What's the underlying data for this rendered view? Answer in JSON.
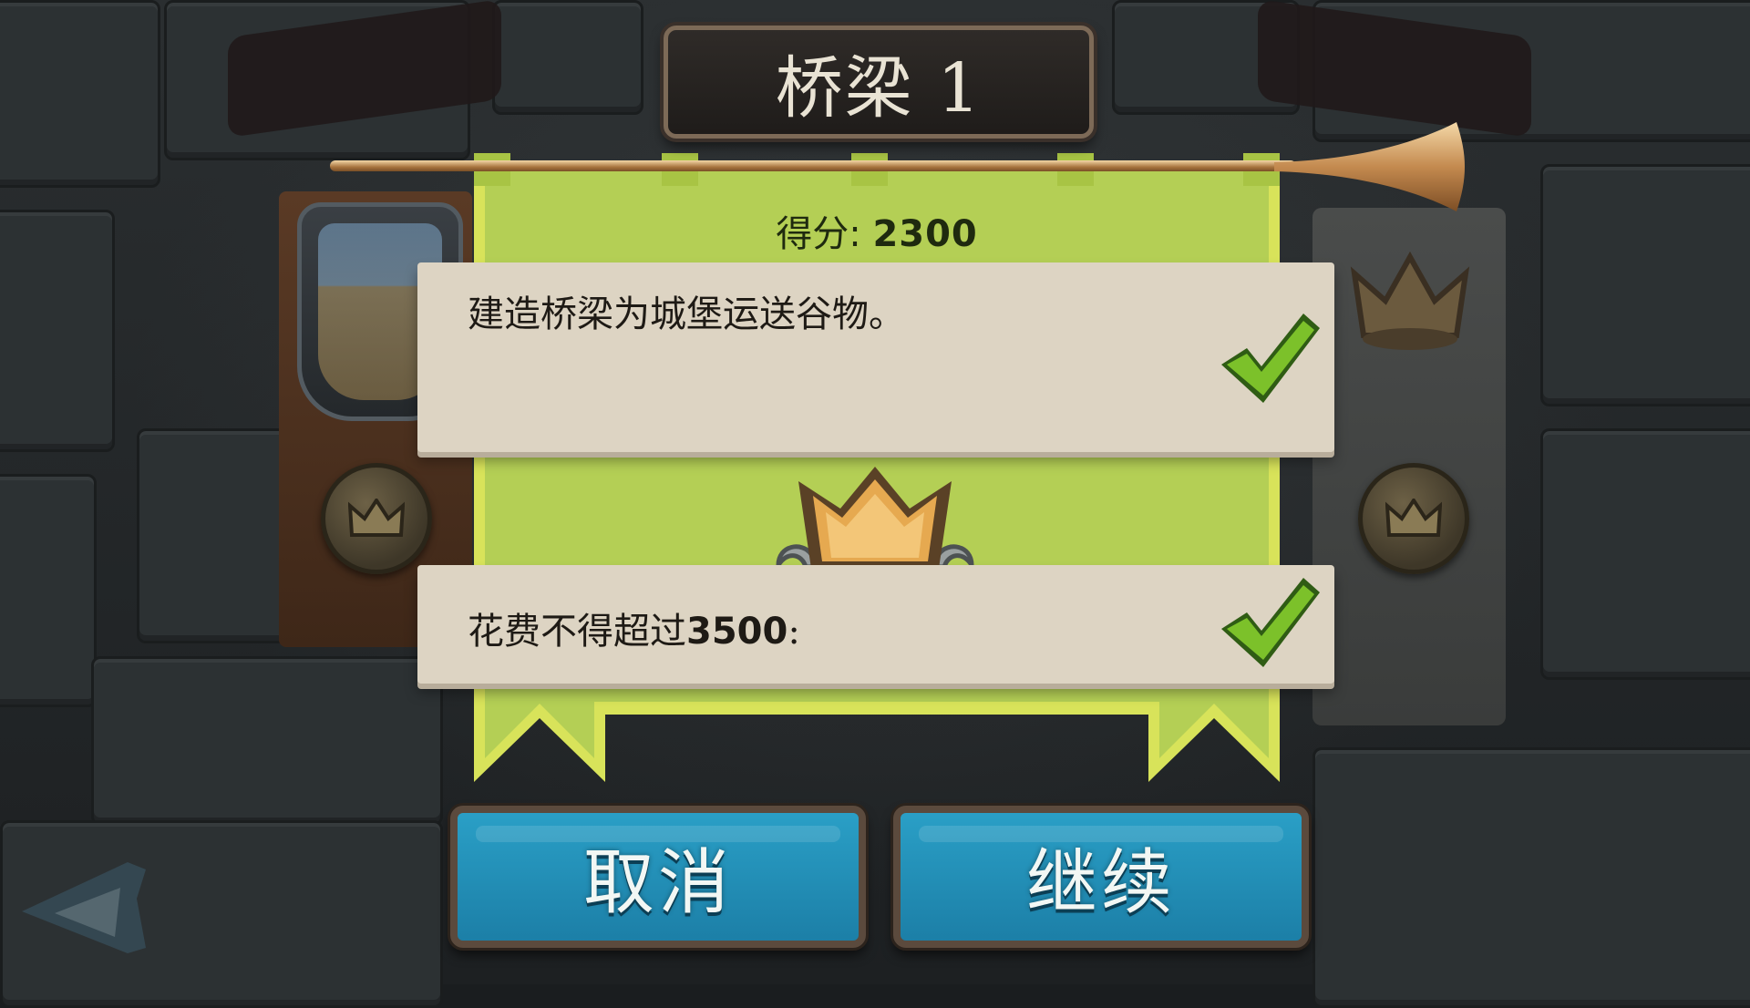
{
  "title": "桥梁 1",
  "score": {
    "label": "得分:",
    "value": "2300"
  },
  "objectives": [
    {
      "text": "建造桥梁为城堡运送谷物。",
      "completed": true
    },
    {
      "text": "花费不得超过",
      "amount": "3500",
      "suffix": ":",
      "completed": true
    }
  ],
  "buttons": {
    "cancel": "取消",
    "continue": "继续"
  },
  "colors": {
    "banner_green": "#b4cf55",
    "button_blue": "#2a9fc6",
    "check_green": "#7cc12a",
    "crown_gold": "#e6a950"
  },
  "icons": [
    "crown-emblem-icon",
    "checkmark-icon",
    "trumpet-icon",
    "back-arrow-icon",
    "wheat-medal-icon"
  ]
}
